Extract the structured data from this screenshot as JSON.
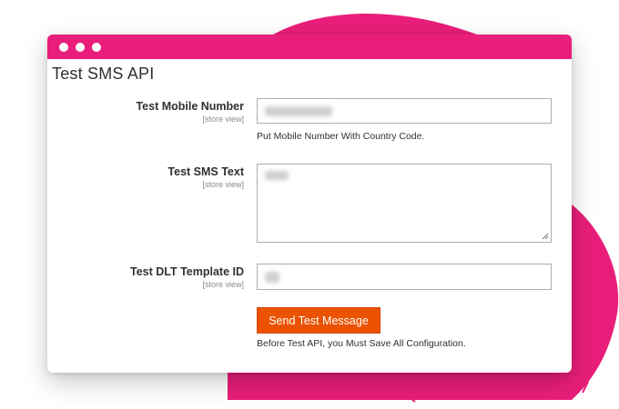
{
  "colors": {
    "accent": "#e91e7a",
    "button": "#eb5202"
  },
  "window": {
    "controls": [
      "window-dot",
      "window-dot",
      "window-dot"
    ]
  },
  "panel": {
    "title": "Test SMS API"
  },
  "fields": {
    "mobile": {
      "label": "Test Mobile Number",
      "scope": "[store view]",
      "note": "Put Mobile Number With Country Code."
    },
    "sms_text": {
      "label": "Test SMS Text",
      "scope": "[store view]"
    },
    "dlt_template": {
      "label": "Test DLT Template ID",
      "scope": "[store view]"
    }
  },
  "actions": {
    "send_label": "Send Test Message",
    "send_note": "Before Test API, you Must Save All Configuration."
  }
}
